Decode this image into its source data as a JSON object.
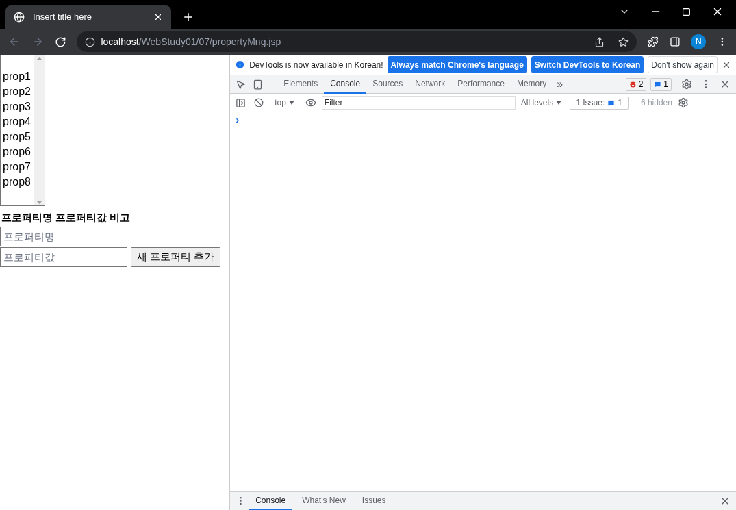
{
  "browser": {
    "tab_title": "Insert title here",
    "url_host": "localhost",
    "url_path": "/WebStudy01/07/propertyMng.jsp",
    "profile_initial": "N"
  },
  "page": {
    "list_items": [
      "prop1",
      "prop2",
      "prop3",
      "prop4",
      "prop5",
      "prop6",
      "prop7",
      "prop8"
    ],
    "table_headers": [
      "프로퍼티명",
      "프로퍼티값",
      "비고"
    ],
    "name_field": {
      "placeholder": "프로퍼티명"
    },
    "value_field": {
      "placeholder": "프로퍼티값"
    },
    "add_button": "새 프로퍼티 추가"
  },
  "devtools": {
    "banner": {
      "message": "DevTools is now available in Korean!",
      "buttons": [
        {
          "label": "Always match Chrome's language",
          "kind": "primary"
        },
        {
          "label": "Switch DevTools to Korean",
          "kind": "primary"
        },
        {
          "label": "Don't show again",
          "kind": "plain"
        }
      ]
    },
    "tabs": [
      {
        "label": "Elements",
        "selected": false
      },
      {
        "label": "Console",
        "selected": true
      },
      {
        "label": "Sources",
        "selected": false
      },
      {
        "label": "Network",
        "selected": false
      },
      {
        "label": "Performance",
        "selected": false
      },
      {
        "label": "Memory",
        "selected": false
      }
    ],
    "more": "»",
    "error_count": "2",
    "message_count": "1",
    "console_toolbar": {
      "context": "top",
      "filter_placeholder": "Filter",
      "levels": "All levels",
      "issues_label": "1 Issue:",
      "issues_count": "1",
      "hidden": "6 hidden"
    },
    "prompt": "›",
    "drawer_tabs": [
      {
        "label": "Console",
        "selected": true
      },
      {
        "label": "What's New",
        "selected": false
      },
      {
        "label": "Issues",
        "selected": false
      }
    ]
  }
}
